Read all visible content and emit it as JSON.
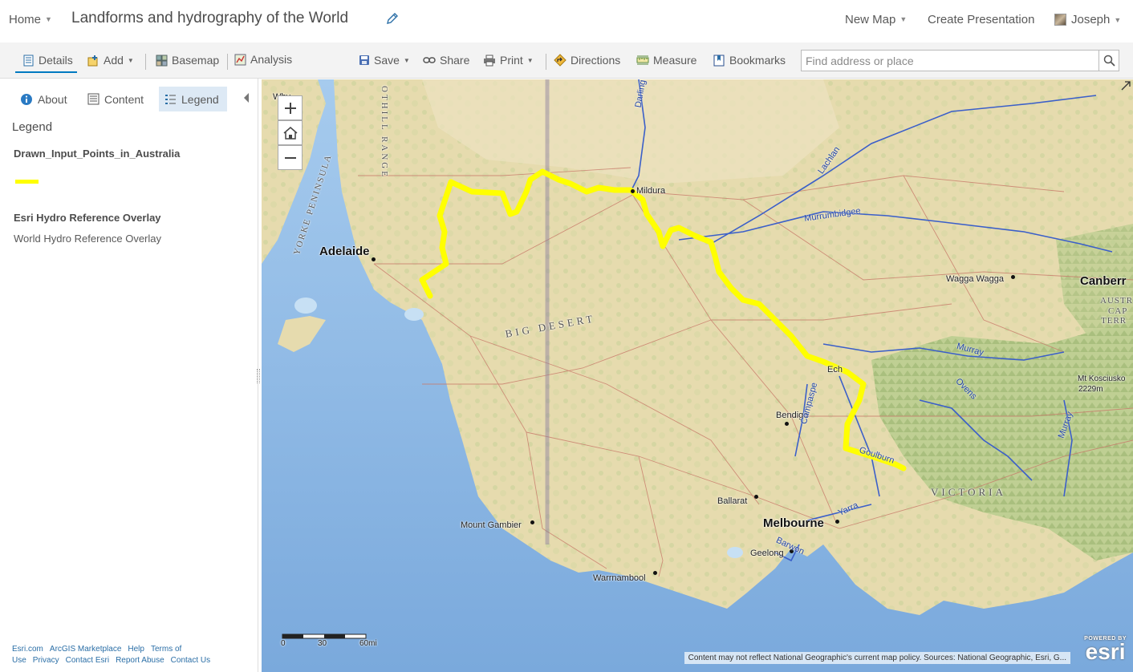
{
  "header": {
    "home_label": "Home",
    "title": "Landforms and hydrography of the World",
    "new_map_label": "New Map",
    "create_presentation_label": "Create Presentation",
    "user_name": "Joseph"
  },
  "toolbar": {
    "details_label": "Details",
    "add_label": "Add",
    "basemap_label": "Basemap",
    "analysis_label": "Analysis",
    "save_label": "Save",
    "share_label": "Share",
    "print_label": "Print",
    "directions_label": "Directions",
    "measure_label": "Measure",
    "bookmarks_label": "Bookmarks",
    "search_placeholder": "Find address or place"
  },
  "panel": {
    "tabs": {
      "about": "About",
      "content": "Content",
      "legend": "Legend"
    },
    "active_tab": "legend",
    "legend_heading": "Legend",
    "layers": [
      {
        "name": "Drawn_Input_Points_in_Australia",
        "symbol_color": "#ffff00"
      },
      {
        "name": "Esri Hydro Reference Overlay",
        "sublayer": "World Hydro Reference Overlay"
      }
    ],
    "footer_links": [
      "Esri.com",
      "ArcGIS Marketplace",
      "Help",
      "Terms of Use",
      "Privacy",
      "Contact Esri",
      "Report Abuse",
      "Contact Us"
    ]
  },
  "map": {
    "places": {
      "adelaide": "Adelaide",
      "mildura": "Mildura",
      "wagga": "Wagga Wagga",
      "canberra": "Canberr",
      "bendigo": "Bendigo",
      "ballarat": "Ballarat",
      "melbourne": "Melbourne",
      "geelong": "Geelong",
      "mount_gambier": "Mount Gambier",
      "warrnambool": "Warrnambool",
      "whyalla": "Why",
      "echuca": "Ech",
      "kosciusko": "Mt Kosciusko",
      "kosciusko_elev": "2229m",
      "act_1": "AUSTR",
      "act_2": "CAP",
      "act_3": "TERR"
    },
    "regions": {
      "victoria": "VICTORIA",
      "big_desert": "BIG DESERT",
      "yorke": "YORKE PENINSULA",
      "lofty": "OTHILL RANGE"
    },
    "rivers": {
      "murrumbidgee": "Murrumbidgee",
      "lachlan": "Lachlan",
      "darling": "Darling",
      "murray": "Murray",
      "murray2": "Murray",
      "ovens": "Ovens",
      "goulburn": "Goulburn",
      "campaspe": "Campaspe",
      "yarra": "Yarra",
      "barwon": "Barwon"
    },
    "scale": {
      "labels": [
        "0",
        "30",
        "60mi"
      ]
    },
    "attribution": "Content may not reflect National Geographic's current map policy. Sources: National Geographic, Esri, G...",
    "logo": {
      "powered": "POWERED BY",
      "word": "esri"
    },
    "colors": {
      "land": "#ecdfb5",
      "water": "#9cc3e8",
      "route": "#ffff00",
      "rivers": "#3b5fc9",
      "roads": "#c87a6a"
    }
  }
}
